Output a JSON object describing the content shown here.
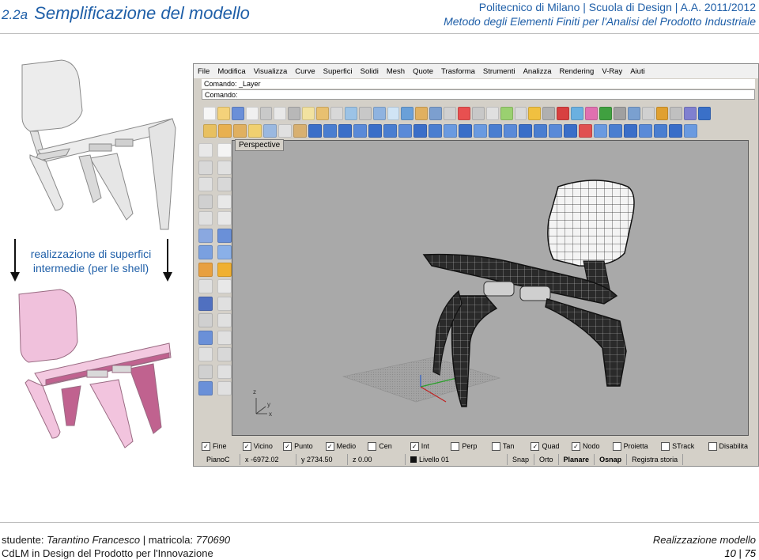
{
  "header": {
    "section_number": "2.2a",
    "title": "Semplificazione del modello",
    "institution": "Politecnico di Milano | Scuola di Design | A.A. 2011/2012",
    "course": "Metodo degli Elementi Finiti per l'Analisi del Prodotto Industriale"
  },
  "left_panel": {
    "caption_line1": "realizzazione di superfici",
    "caption_line2": "intermedie (per le shell)",
    "colors": {
      "top_chair": "#e9e9e9",
      "bottom_chair": "#ebb6d4",
      "bottom_chair_accent": "#c0628f"
    }
  },
  "rhino": {
    "menu": [
      "File",
      "Modifica",
      "Visualizza",
      "Curve",
      "Superfici",
      "Solidi",
      "Mesh",
      "Quote",
      "Trasforma",
      "Strumenti",
      "Analizza",
      "Rendering",
      "V-Ray",
      "Aiuti"
    ],
    "command_history": "Comando: _Layer",
    "command_prompt": "Comando:",
    "viewport_label": "Perspective",
    "axis_labels": {
      "z": "z",
      "x": "x",
      "y": "y"
    },
    "osnaps": [
      {
        "label": "Fine",
        "checked": true
      },
      {
        "label": "Vicino",
        "checked": true
      },
      {
        "label": "Punto",
        "checked": true
      },
      {
        "label": "Medio",
        "checked": true
      },
      {
        "label": "Cen",
        "checked": false
      },
      {
        "label": "Int",
        "checked": true
      },
      {
        "label": "Perp",
        "checked": false
      },
      {
        "label": "Tan",
        "checked": false
      },
      {
        "label": "Quad",
        "checked": true
      },
      {
        "label": "Nodo",
        "checked": true
      },
      {
        "label": "Proietta",
        "checked": false
      },
      {
        "label": "STrack",
        "checked": false
      },
      {
        "label": "Disabilita",
        "checked": false
      }
    ],
    "status": {
      "plane": "PianoC",
      "x": "x -6972.02",
      "y": "y 2734.50",
      "z": "z 0.00",
      "layer": "Livello 01",
      "snap": "Snap",
      "orto": "Orto",
      "planare": "Planare",
      "osnap": "Osnap",
      "history": "Registra storia"
    },
    "check_mark": "✓"
  },
  "footer": {
    "student_label": "studente:",
    "student_name": "Tarantino Francesco",
    "matricola_label": "matricola:",
    "matricola": "770690",
    "degree": "CdLM in Design del Prodotto per l'Innovazione",
    "topic": "Realizzazione modello",
    "page": "10",
    "total": "75"
  }
}
